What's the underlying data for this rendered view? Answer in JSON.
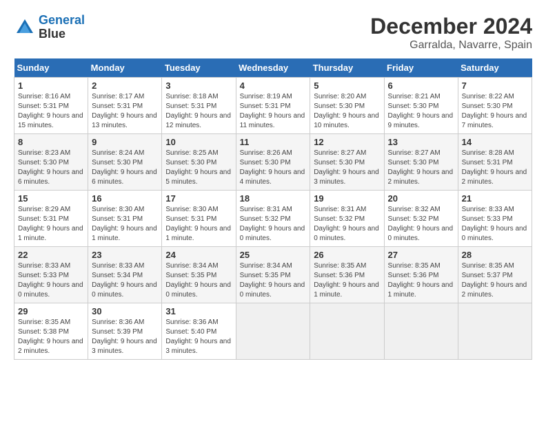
{
  "logo": {
    "line1": "General",
    "line2": "Blue"
  },
  "title": "December 2024",
  "location": "Garralda, Navarre, Spain",
  "days_of_week": [
    "Sunday",
    "Monday",
    "Tuesday",
    "Wednesday",
    "Thursday",
    "Friday",
    "Saturday"
  ],
  "weeks": [
    [
      {
        "day": "1",
        "info": "Sunrise: 8:16 AM\nSunset: 5:31 PM\nDaylight: 9 hours and 15 minutes."
      },
      {
        "day": "2",
        "info": "Sunrise: 8:17 AM\nSunset: 5:31 PM\nDaylight: 9 hours and 13 minutes."
      },
      {
        "day": "3",
        "info": "Sunrise: 8:18 AM\nSunset: 5:31 PM\nDaylight: 9 hours and 12 minutes."
      },
      {
        "day": "4",
        "info": "Sunrise: 8:19 AM\nSunset: 5:31 PM\nDaylight: 9 hours and 11 minutes."
      },
      {
        "day": "5",
        "info": "Sunrise: 8:20 AM\nSunset: 5:30 PM\nDaylight: 9 hours and 10 minutes."
      },
      {
        "day": "6",
        "info": "Sunrise: 8:21 AM\nSunset: 5:30 PM\nDaylight: 9 hours and 9 minutes."
      },
      {
        "day": "7",
        "info": "Sunrise: 8:22 AM\nSunset: 5:30 PM\nDaylight: 9 hours and 7 minutes."
      }
    ],
    [
      {
        "day": "8",
        "info": "Sunrise: 8:23 AM\nSunset: 5:30 PM\nDaylight: 9 hours and 6 minutes."
      },
      {
        "day": "9",
        "info": "Sunrise: 8:24 AM\nSunset: 5:30 PM\nDaylight: 9 hours and 6 minutes."
      },
      {
        "day": "10",
        "info": "Sunrise: 8:25 AM\nSunset: 5:30 PM\nDaylight: 9 hours and 5 minutes."
      },
      {
        "day": "11",
        "info": "Sunrise: 8:26 AM\nSunset: 5:30 PM\nDaylight: 9 hours and 4 minutes."
      },
      {
        "day": "12",
        "info": "Sunrise: 8:27 AM\nSunset: 5:30 PM\nDaylight: 9 hours and 3 minutes."
      },
      {
        "day": "13",
        "info": "Sunrise: 8:27 AM\nSunset: 5:30 PM\nDaylight: 9 hours and 2 minutes."
      },
      {
        "day": "14",
        "info": "Sunrise: 8:28 AM\nSunset: 5:31 PM\nDaylight: 9 hours and 2 minutes."
      }
    ],
    [
      {
        "day": "15",
        "info": "Sunrise: 8:29 AM\nSunset: 5:31 PM\nDaylight: 9 hours and 1 minute."
      },
      {
        "day": "16",
        "info": "Sunrise: 8:30 AM\nSunset: 5:31 PM\nDaylight: 9 hours and 1 minute."
      },
      {
        "day": "17",
        "info": "Sunrise: 8:30 AM\nSunset: 5:31 PM\nDaylight: 9 hours and 1 minute."
      },
      {
        "day": "18",
        "info": "Sunrise: 8:31 AM\nSunset: 5:32 PM\nDaylight: 9 hours and 0 minutes."
      },
      {
        "day": "19",
        "info": "Sunrise: 8:31 AM\nSunset: 5:32 PM\nDaylight: 9 hours and 0 minutes."
      },
      {
        "day": "20",
        "info": "Sunrise: 8:32 AM\nSunset: 5:32 PM\nDaylight: 9 hours and 0 minutes."
      },
      {
        "day": "21",
        "info": "Sunrise: 8:33 AM\nSunset: 5:33 PM\nDaylight: 9 hours and 0 minutes."
      }
    ],
    [
      {
        "day": "22",
        "info": "Sunrise: 8:33 AM\nSunset: 5:33 PM\nDaylight: 9 hours and 0 minutes."
      },
      {
        "day": "23",
        "info": "Sunrise: 8:33 AM\nSunset: 5:34 PM\nDaylight: 9 hours and 0 minutes."
      },
      {
        "day": "24",
        "info": "Sunrise: 8:34 AM\nSunset: 5:35 PM\nDaylight: 9 hours and 0 minutes."
      },
      {
        "day": "25",
        "info": "Sunrise: 8:34 AM\nSunset: 5:35 PM\nDaylight: 9 hours and 0 minutes."
      },
      {
        "day": "26",
        "info": "Sunrise: 8:35 AM\nSunset: 5:36 PM\nDaylight: 9 hours and 1 minute."
      },
      {
        "day": "27",
        "info": "Sunrise: 8:35 AM\nSunset: 5:36 PM\nDaylight: 9 hours and 1 minute."
      },
      {
        "day": "28",
        "info": "Sunrise: 8:35 AM\nSunset: 5:37 PM\nDaylight: 9 hours and 2 minutes."
      }
    ],
    [
      {
        "day": "29",
        "info": "Sunrise: 8:35 AM\nSunset: 5:38 PM\nDaylight: 9 hours and 2 minutes."
      },
      {
        "day": "30",
        "info": "Sunrise: 8:36 AM\nSunset: 5:39 PM\nDaylight: 9 hours and 3 minutes."
      },
      {
        "day": "31",
        "info": "Sunrise: 8:36 AM\nSunset: 5:40 PM\nDaylight: 9 hours and 3 minutes."
      },
      null,
      null,
      null,
      null
    ]
  ]
}
